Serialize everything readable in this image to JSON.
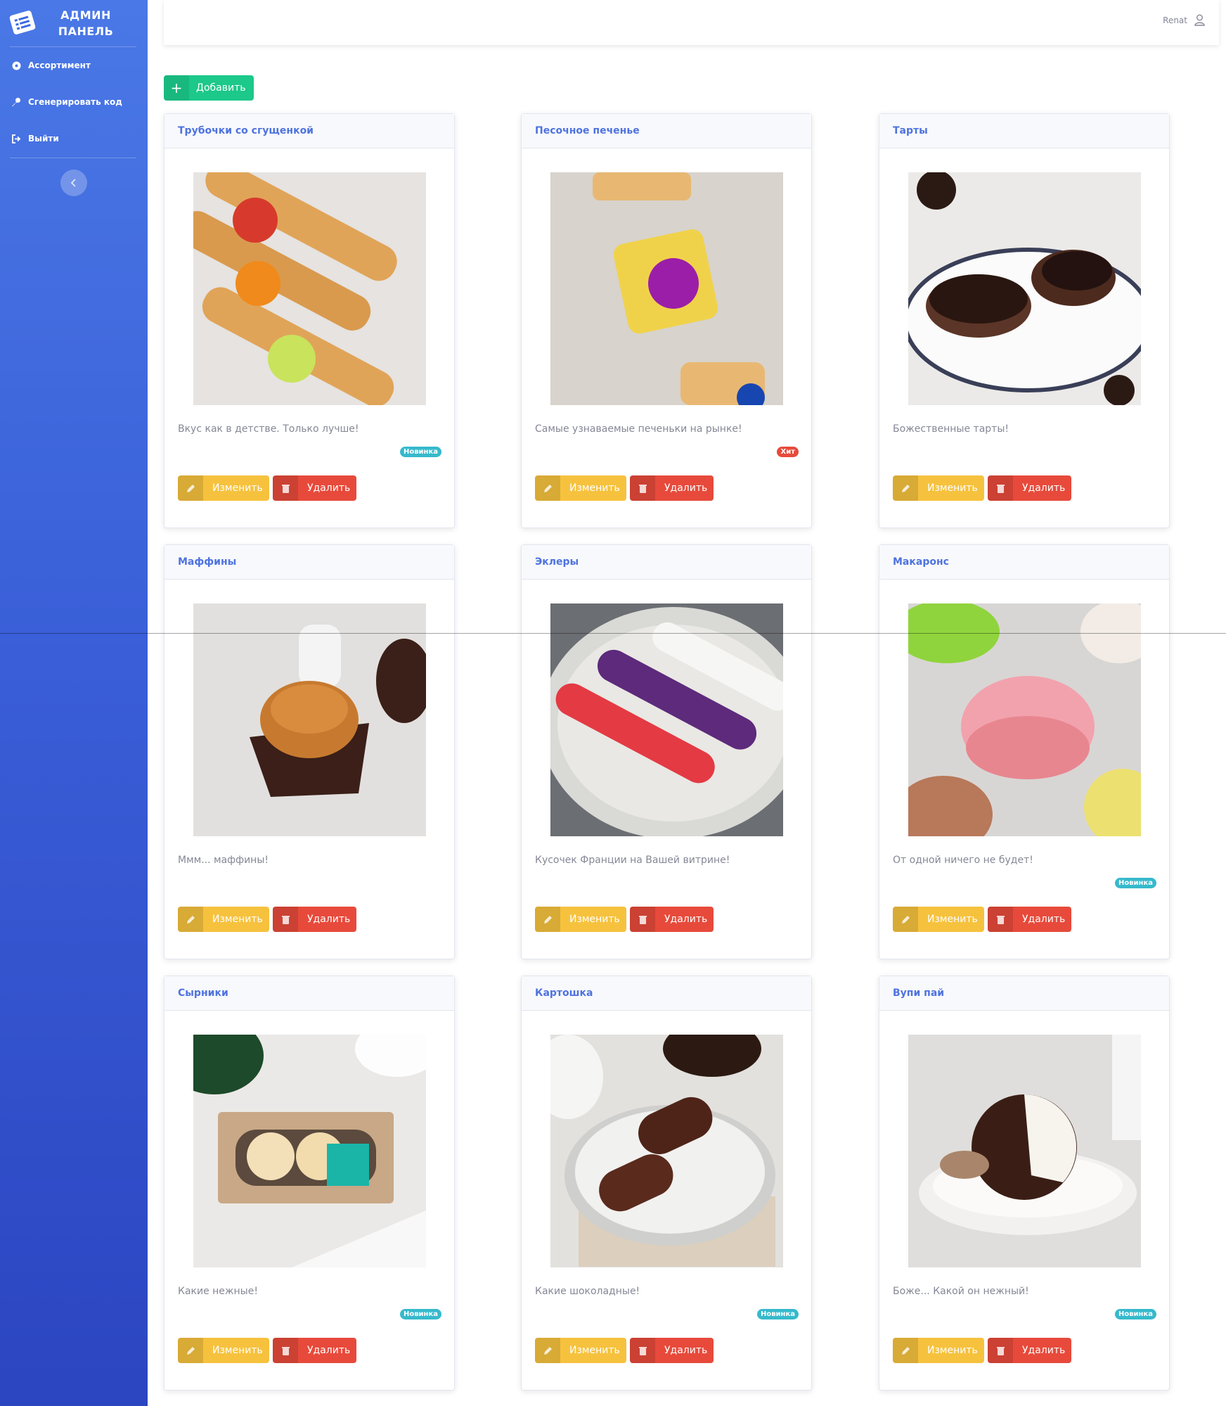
{
  "sidebar": {
    "brand_line1": "АДМИН",
    "brand_line2": "ПАНЕЛЬ",
    "items": [
      {
        "label": "Ассортимент",
        "icon": "circle-icon"
      },
      {
        "label": "Сгенерировать код",
        "icon": "key-icon"
      },
      {
        "label": "Выйти",
        "icon": "sign-out-icon"
      }
    ],
    "collapse_icon": "chevron-left-icon"
  },
  "topbar": {
    "user_name": "Renat",
    "user_icon": "user-icon"
  },
  "toolbar": {
    "add_label": "Добавить",
    "add_icon": "plus-icon"
  },
  "actions": {
    "edit_label": "Изменить",
    "delete_label": "Удалить",
    "edit_icon": "pencil-icon",
    "delete_icon": "trash-icon"
  },
  "products": [
    {
      "title": "Трубочки со сгущенкой",
      "description": "Вкус как в детстве. Только лучше!",
      "badge": "Новинка",
      "badge_type": "new"
    },
    {
      "title": "Песочное печенье",
      "description": "Самые узнаваемые печеньки на рынке!",
      "badge": "Хит",
      "badge_type": "hit"
    },
    {
      "title": "Тарты",
      "description": "Божественные тарты!",
      "badge": "",
      "badge_type": ""
    },
    {
      "title": "Маффины",
      "description": "Ммм... маффины!",
      "badge": "",
      "badge_type": ""
    },
    {
      "title": "Эклеры",
      "description": "Кусочек Франции на Вашей витрине!",
      "badge": "",
      "badge_type": ""
    },
    {
      "title": "Макаронс",
      "description": "От одной ничего не будет!",
      "badge": "Новинка",
      "badge_type": "new"
    },
    {
      "title": "Сырники",
      "description": "Какие нежные!",
      "badge": "Новинка",
      "badge_type": "new"
    },
    {
      "title": "Картошка",
      "description": "Какие шоколадные!",
      "badge": "Новинка",
      "badge_type": "new"
    },
    {
      "title": "Вупи пай",
      "description": "Боже... Какой он нежный!",
      "badge": "Новинка",
      "badge_type": "new"
    }
  ],
  "colors": {
    "primary": "#4e73df",
    "success": "#1cc88a",
    "warning": "#f6c23e",
    "danger": "#e74a3b",
    "info": "#36b9cc"
  }
}
